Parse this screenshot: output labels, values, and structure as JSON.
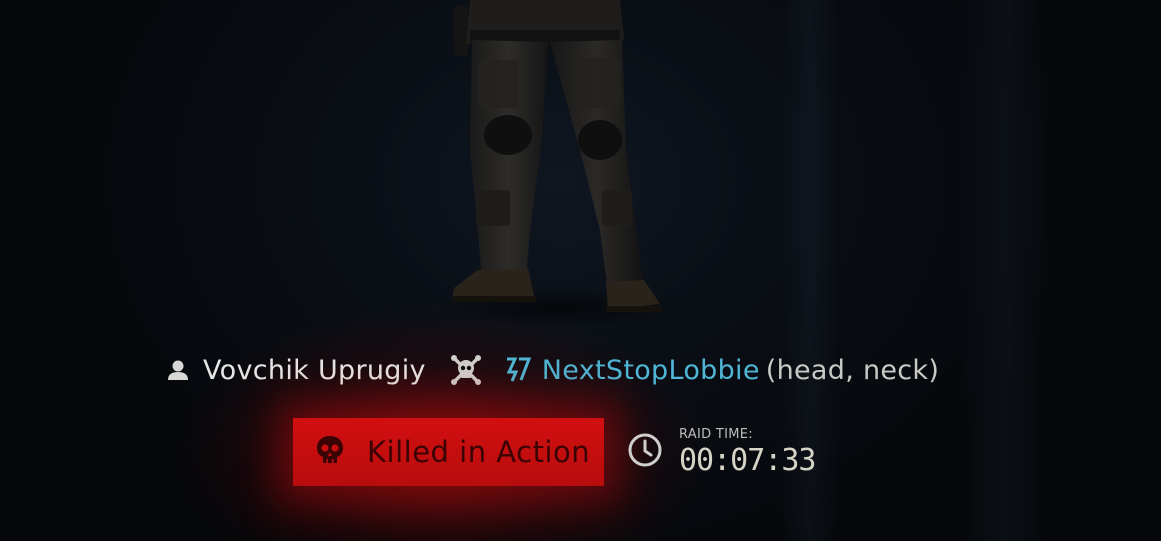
{
  "kill_info": {
    "victim_icon": "player-icon",
    "victim_name": "Vovchik Uprugiy",
    "killed_by_icon": "skull-crossbones-icon",
    "killer_faction_icon": "bear-faction-icon",
    "killer_name": "NextStopLobbie",
    "body_parts": "(head, neck)"
  },
  "status": {
    "icon": "skull-icon",
    "label": "Killed in Action",
    "color": "#d20f10"
  },
  "raid_time": {
    "icon": "clock-icon",
    "label": "RAID TIME:",
    "value": "00:07:33"
  },
  "colors": {
    "killer_name": "#4fb6d6",
    "text": "#e6e6e4"
  }
}
